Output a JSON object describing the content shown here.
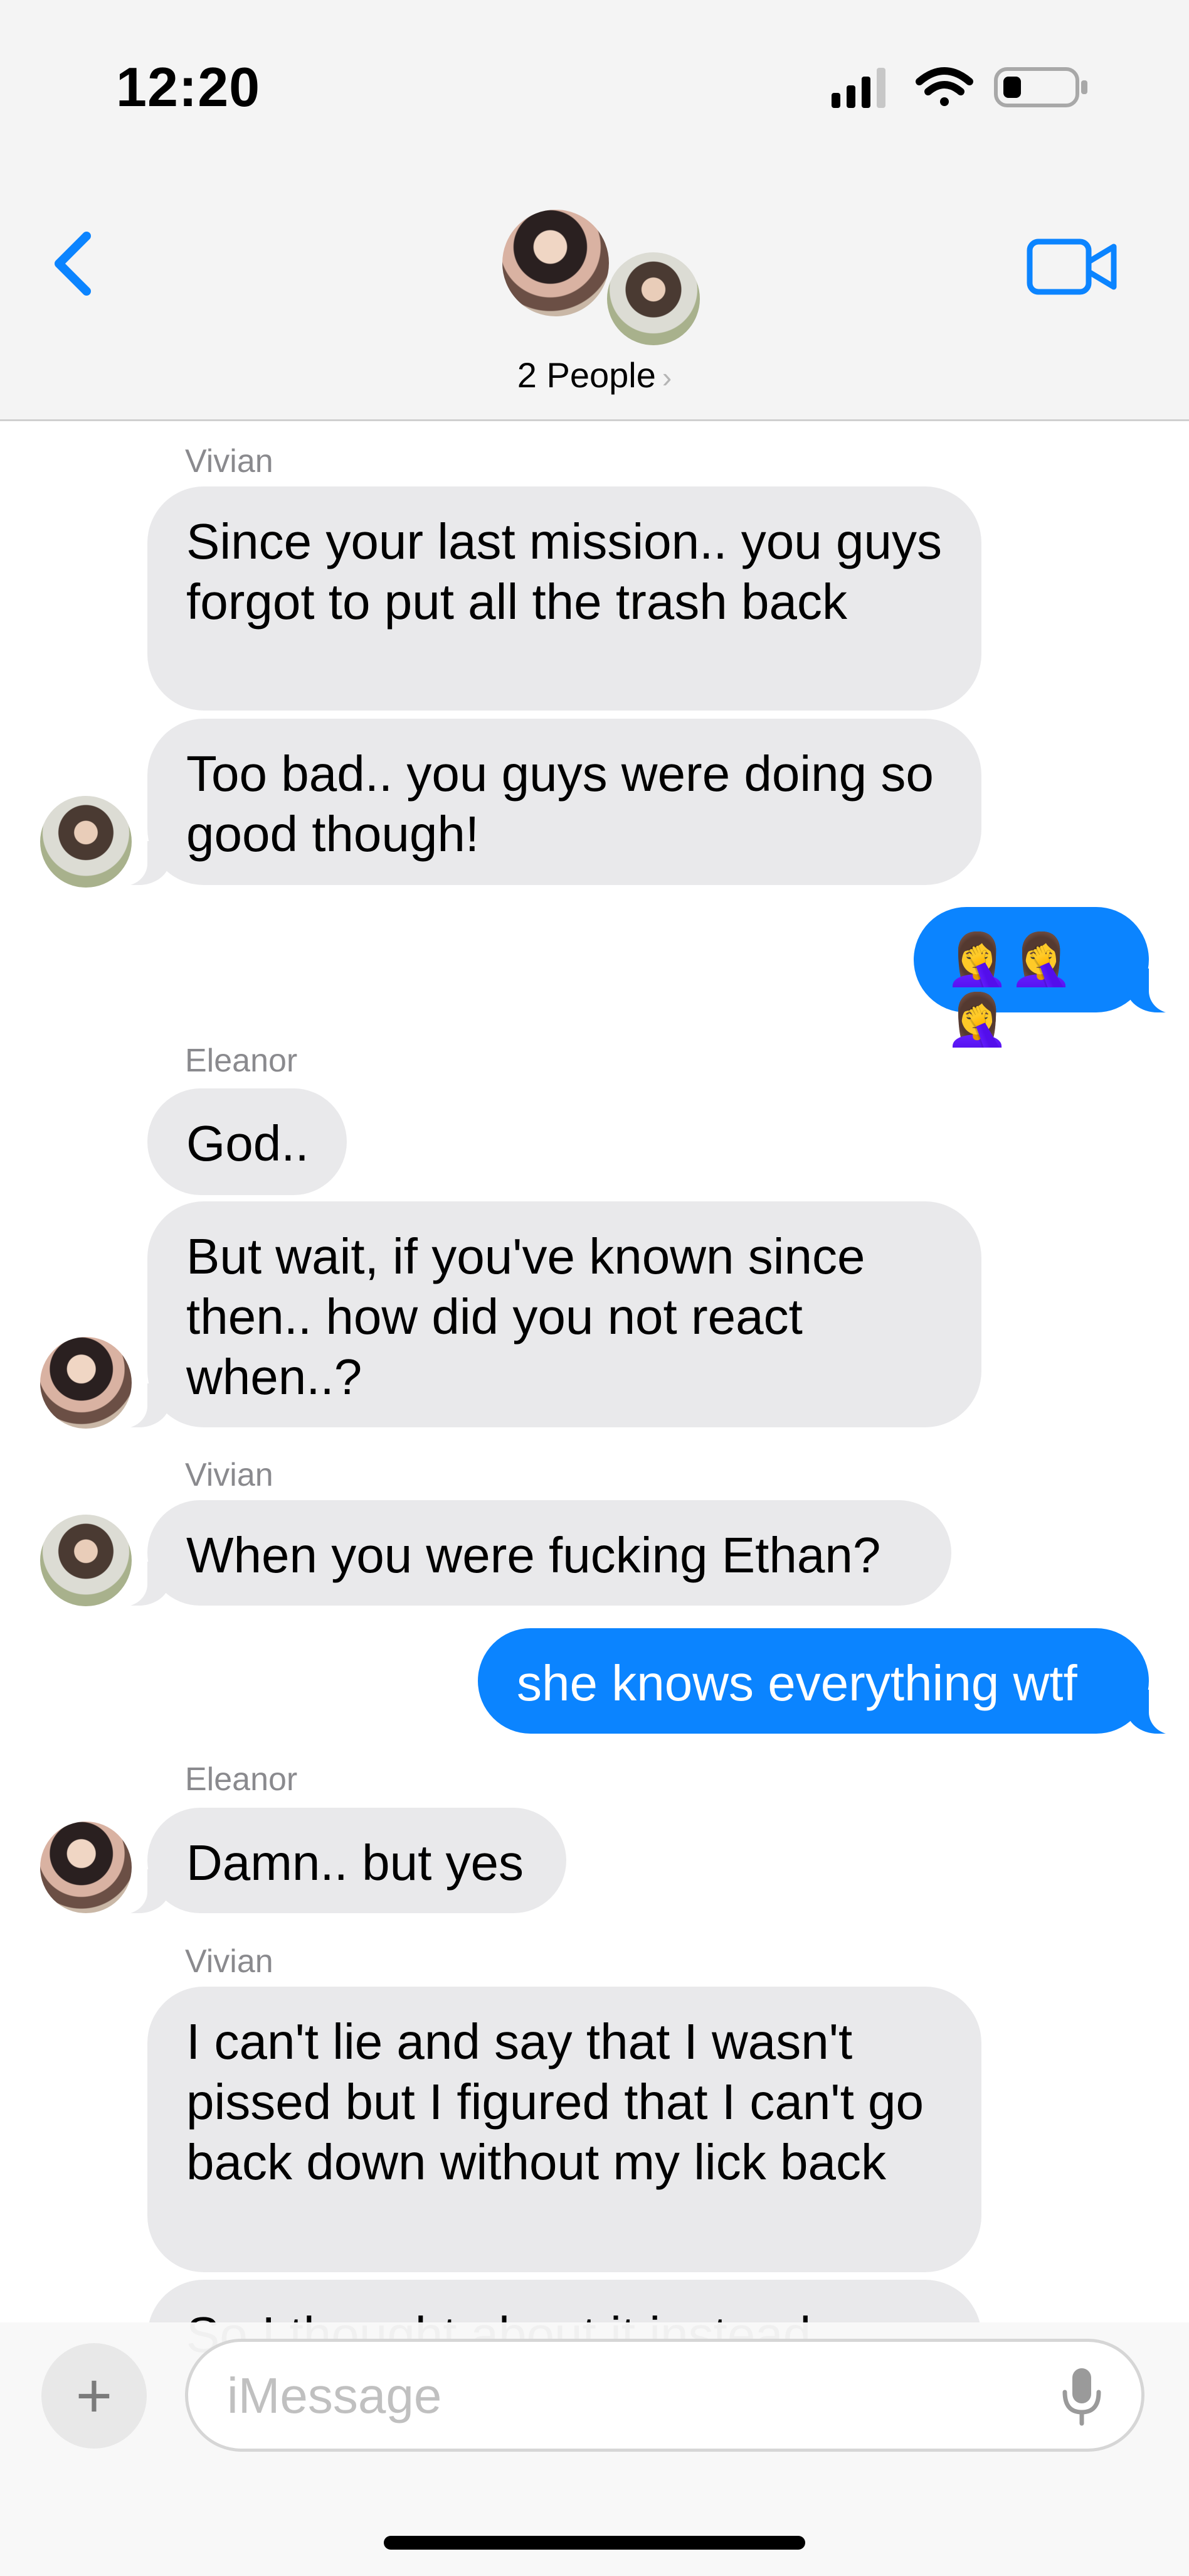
{
  "status_bar": {
    "time": "12:20",
    "icons": [
      "cellular-signal-icon",
      "wifi-icon",
      "battery-low-icon"
    ]
  },
  "header": {
    "back_icon": "chevron-left-icon",
    "video_icon": "video-camera-icon",
    "group_label": "2 People",
    "group_chevron": "›",
    "accent_color": "#0b84ff"
  },
  "messages": [
    {
      "sender": "Vivian",
      "direction": "incoming",
      "text": "Since your last mission.. you guys forgot to put all the trash back"
    },
    {
      "sender": "Vivian",
      "direction": "incoming",
      "text": "Too bad.. you guys were doing so good though!"
    },
    {
      "sender": "Me",
      "direction": "outgoing",
      "text": "🤦‍♀️🤦‍♀️🤦‍♀️"
    },
    {
      "sender": "Eleanor",
      "direction": "incoming",
      "text": "God.."
    },
    {
      "sender": "Eleanor",
      "direction": "incoming",
      "text": "But wait, if you've known since then.. how did you not react when..?"
    },
    {
      "sender": "Vivian",
      "direction": "incoming",
      "text": "When you were fucking Ethan?"
    },
    {
      "sender": "Me",
      "direction": "outgoing",
      "text": "she knows everything wtf"
    },
    {
      "sender": "Eleanor",
      "direction": "incoming",
      "text": "Damn.. but yes"
    },
    {
      "sender": "Vivian",
      "direction": "incoming",
      "text": "I can't lie and say that I wasn't pissed but I figured that I can't go back down without my lick back"
    },
    {
      "sender": "Vivian",
      "direction": "incoming",
      "text": "So I thought about it instead"
    }
  ],
  "sender_labels": {
    "vivian_1": "Vivian",
    "eleanor_1": "Eleanor",
    "vivian_2": "Vivian",
    "eleanor_2": "Eleanor",
    "vivian_3": "Vivian"
  },
  "composer": {
    "plus_label": "+",
    "placeholder": "iMessage",
    "value": "",
    "mic_icon": "microphone-icon"
  },
  "colors": {
    "incoming_bubble": "#e9e9eb",
    "outgoing_bubble": "#0b84ff",
    "header_bg": "#f4f4f4"
  }
}
